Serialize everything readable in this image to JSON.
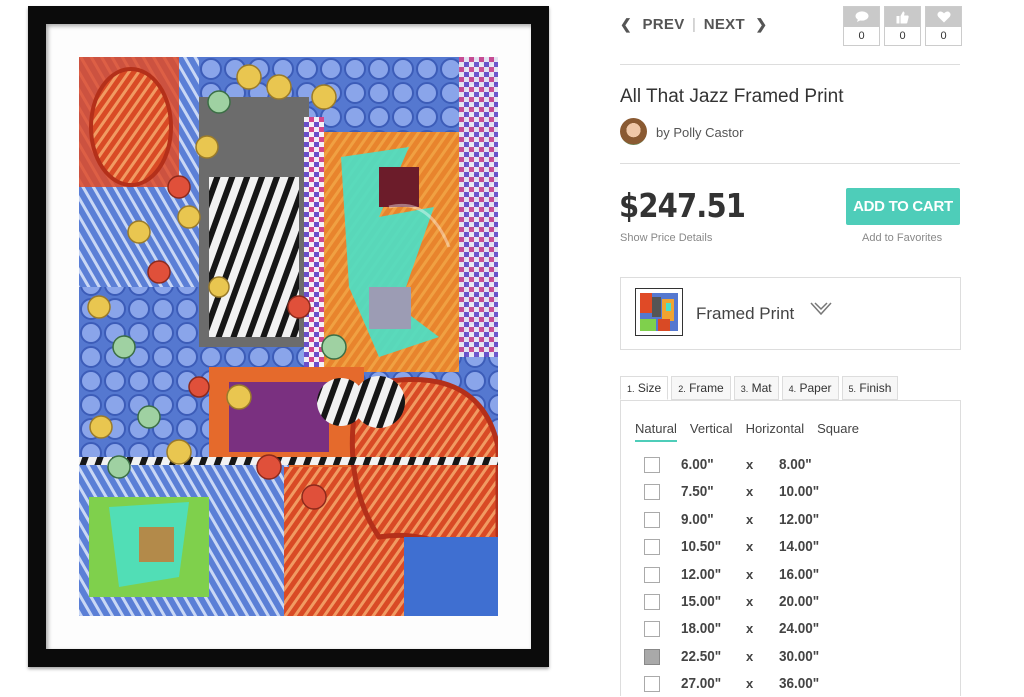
{
  "nav": {
    "prev": "PREV",
    "next": "NEXT",
    "separator": "|"
  },
  "social": [
    {
      "icon": "comment-icon",
      "count": "0"
    },
    {
      "icon": "thumbs-up-icon",
      "count": "0"
    },
    {
      "icon": "heart-icon",
      "count": "0"
    }
  ],
  "product": {
    "title": "All That Jazz Framed Print",
    "byline": "by Polly Castor",
    "price": "$247.51",
    "price_details": "Show Price Details",
    "add_to_cart": "ADD TO CART",
    "add_to_favorites": "Add to Favorites",
    "type": "Framed Print"
  },
  "tabs": [
    {
      "num": "1.",
      "label": "Size"
    },
    {
      "num": "2.",
      "label": "Frame"
    },
    {
      "num": "3.",
      "label": "Mat"
    },
    {
      "num": "4.",
      "label": "Paper"
    },
    {
      "num": "5.",
      "label": "Finish"
    }
  ],
  "orientation": [
    "Natural",
    "Vertical",
    "Horizontal",
    "Square"
  ],
  "size_separator": "x",
  "sizes": [
    {
      "w": "6.00\"",
      "h": "8.00\"",
      "checked": false
    },
    {
      "w": "7.50\"",
      "h": "10.00\"",
      "checked": false
    },
    {
      "w": "9.00\"",
      "h": "12.00\"",
      "checked": false
    },
    {
      "w": "10.50\"",
      "h": "14.00\"",
      "checked": false
    },
    {
      "w": "12.00\"",
      "h": "16.00\"",
      "checked": false
    },
    {
      "w": "15.00\"",
      "h": "20.00\"",
      "checked": false
    },
    {
      "w": "18.00\"",
      "h": "24.00\"",
      "checked": false
    },
    {
      "w": "22.50\"",
      "h": "30.00\"",
      "checked": true
    },
    {
      "w": "27.00\"",
      "h": "36.00\"",
      "checked": false
    }
  ],
  "colors": {
    "accent": "#4ecdb9",
    "frame": "#0b0b0b",
    "social_box": "#c9c9c9",
    "checked_box": "#a9a9a9"
  }
}
